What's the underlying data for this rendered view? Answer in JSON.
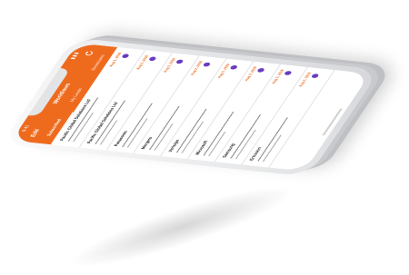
{
  "app": {
    "edit_label": "Edit",
    "title": "Workflows",
    "refresh_icon": "refresh-icon",
    "status": {
      "time": "9:41",
      "indicators": "▮▮▮"
    },
    "accent_color": "#ee6b1e",
    "badge_color": "#6a3cc0"
  },
  "tabs": [
    {
      "label": "Subscribed"
    },
    {
      "label": "My Leads"
    },
    {
      "label": "Bookmarks"
    }
  ],
  "items": [
    {
      "name": "Pacific Global Solutions Ltd",
      "date": "Aug 2, 2019"
    },
    {
      "name": "Pacific Global Solutions Ltd",
      "date": "Aug 2, 2019"
    },
    {
      "name": "Panasonic",
      "date": "Aug 2, 2019"
    },
    {
      "name": "Mergers",
      "date": "Aug 2, 2019"
    },
    {
      "name": "Verisign",
      "date": "Aug 2, 2019"
    },
    {
      "name": "Microsoft",
      "date": "Aug 2, 2019"
    },
    {
      "name": "Samsung",
      "date": "Aug 2, 2019"
    },
    {
      "name": "Ericsson",
      "date": "Aug 2, 2019"
    }
  ]
}
